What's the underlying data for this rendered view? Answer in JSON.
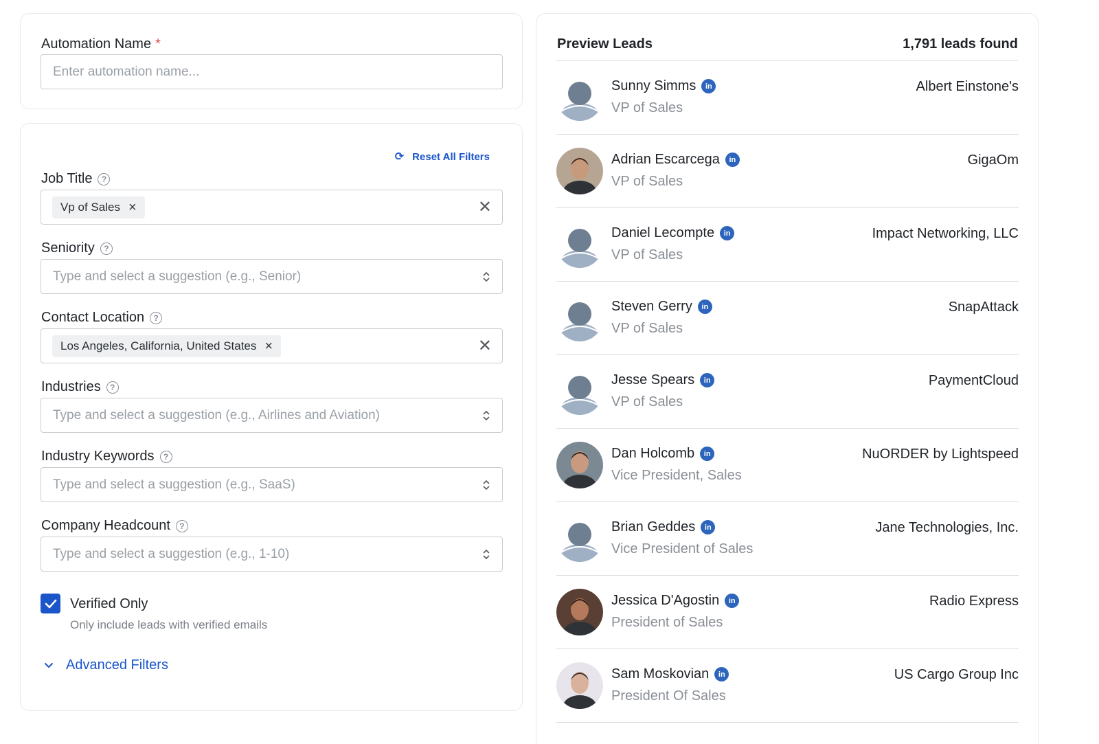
{
  "automation": {
    "label": "Automation Name",
    "required_mark": "*",
    "placeholder": "Enter automation name..."
  },
  "filters": {
    "reset_label": "Reset All Filters",
    "job_title": {
      "label": "Job Title",
      "chips": [
        "Vp of Sales"
      ]
    },
    "seniority": {
      "label": "Seniority",
      "placeholder": "Type and select a suggestion (e.g., Senior)"
    },
    "contact_location": {
      "label": "Contact Location",
      "chips": [
        "Los Angeles, California, United States"
      ]
    },
    "industries": {
      "label": "Industries",
      "placeholder": "Type and select a suggestion (e.g., Airlines and Aviation)"
    },
    "industry_keywords": {
      "label": "Industry Keywords",
      "placeholder": "Type and select a suggestion (e.g., SaaS)"
    },
    "company_headcount": {
      "label": "Company Headcount",
      "placeholder": "Type and select a suggestion (e.g., 1-10)"
    },
    "verified": {
      "label": "Verified Only",
      "sublabel": "Only include leads with verified emails",
      "checked": true
    },
    "advanced_label": "Advanced Filters"
  },
  "preview": {
    "title": "Preview Leads",
    "count": "1,791 leads found",
    "leads": [
      {
        "name": "Sunny Simms",
        "title": "VP of Sales",
        "company": "Albert Einstone's",
        "avatar": "placeholder"
      },
      {
        "name": "Adrian Escarcega",
        "title": "VP of Sales",
        "company": "GigaOm",
        "avatar": "photo"
      },
      {
        "name": "Daniel Lecompte",
        "title": "VP of Sales",
        "company": "Impact Networking, LLC",
        "avatar": "placeholder"
      },
      {
        "name": "Steven Gerry",
        "title": "VP of Sales",
        "company": "SnapAttack",
        "avatar": "placeholder"
      },
      {
        "name": "Jesse Spears",
        "title": "VP of Sales",
        "company": "PaymentCloud",
        "avatar": "placeholder"
      },
      {
        "name": "Dan Holcomb",
        "title": "Vice President, Sales",
        "company": "NuORDER by Lightspeed",
        "avatar": "photo"
      },
      {
        "name": "Brian Geddes",
        "title": "Vice President of Sales",
        "company": "Jane Technologies, Inc.",
        "avatar": "placeholder"
      },
      {
        "name": "Jessica D'Agostin",
        "title": "President of Sales",
        "company": "Radio Express",
        "avatar": "photo"
      },
      {
        "name": "Sam Moskovian",
        "title": "President Of Sales",
        "company": "US Cargo Group Inc",
        "avatar": "photo"
      }
    ]
  },
  "icons": {
    "help": "question-circle-icon",
    "linkedin": "linkedin-icon",
    "clear": "close-icon",
    "select": "chevron-updown-icon",
    "reset": "refresh-icon",
    "advanced": "chevron-down-icon"
  },
  "colors": {
    "accent": "#1a55c9",
    "linkedin": "#2d64bc",
    "required": "#d9534f"
  }
}
